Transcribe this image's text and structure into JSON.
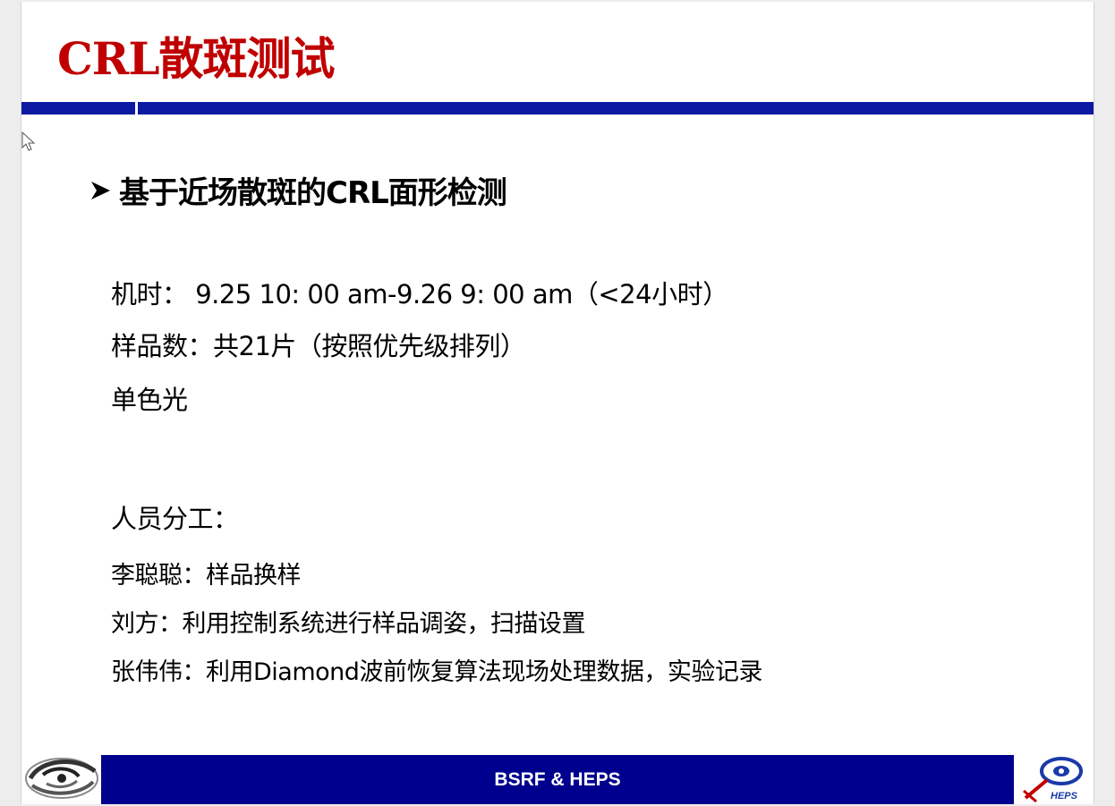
{
  "slide": {
    "title": "CRL散斑测试",
    "heading": "基于近场散斑的CRL面形检测",
    "lines": {
      "machine_time": "机时：  9.25 10: 00 am-9.26 9: 00 am（<24小时）",
      "samples": "样品数：共21片（按照优先级排列）",
      "light": "单色光",
      "staff_heading": "人员分工：",
      "staff_1": "李聪聪：样品换样",
      "staff_2": "刘方：利用控制系统进行样品调姿，扫描设置",
      "staff_3": "张伟伟：利用Diamond波前恢复算法现场处理数据，实验记录"
    },
    "footer": {
      "text": "BSRF & HEPS",
      "right_logo_text": "HEPS",
      "left_logo_icon": "ihep-swirl-logo-icon",
      "right_logo_icon": "heps-logo-icon"
    }
  },
  "colors": {
    "title": "#c00000",
    "header_bar": "#0b1aa0",
    "footer_bar": "#00008f"
  }
}
